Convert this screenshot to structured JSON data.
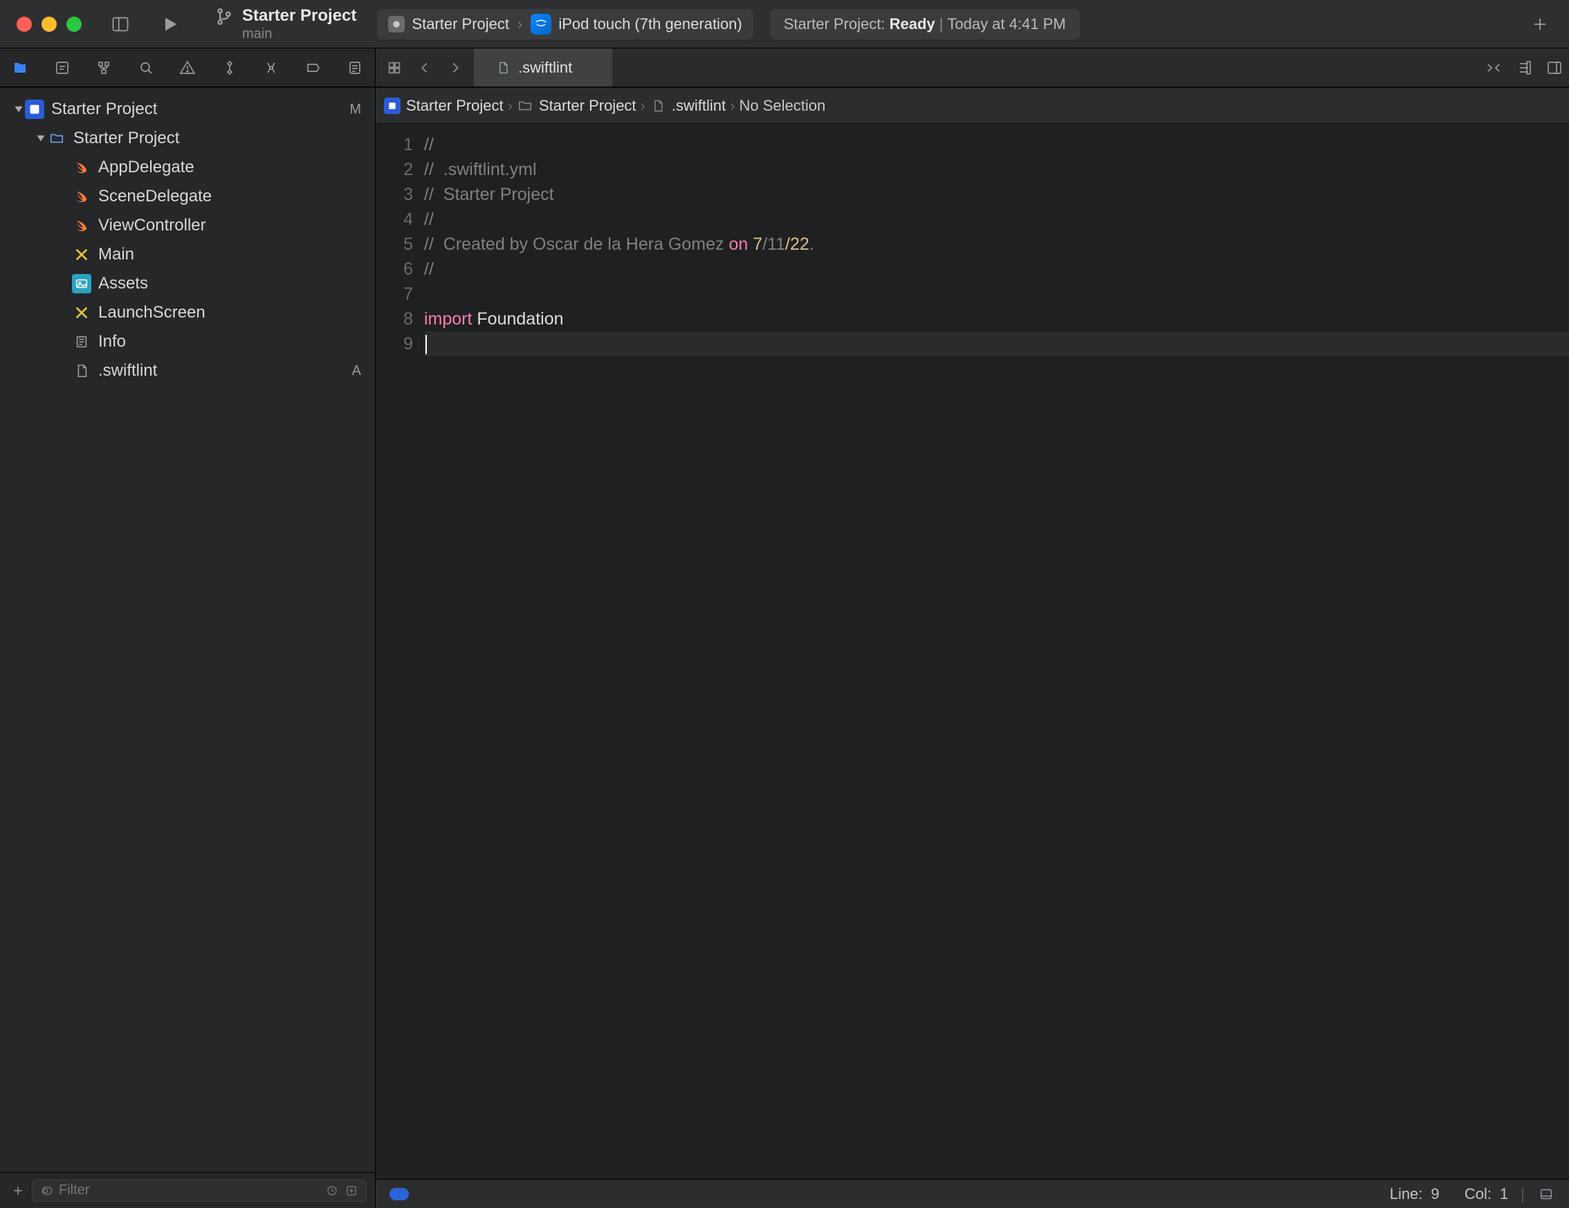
{
  "titlebar": {
    "project_title": "Starter Project",
    "branch": "main",
    "scheme": "Starter Project",
    "device": "iPod touch (7th generation)",
    "status_prefix": "Starter Project:",
    "status_state": "Ready",
    "status_time": "Today at 4:41 PM"
  },
  "navigator_icons": [
    "folder",
    "source-control",
    "symbols",
    "search",
    "issues",
    "tests",
    "debug",
    "breakpoints",
    "reports"
  ],
  "tree": {
    "root": {
      "name": "Starter Project",
      "badge": "M"
    },
    "group": {
      "name": "Starter Project"
    },
    "files": [
      {
        "name": "AppDelegate",
        "type": "swift"
      },
      {
        "name": "SceneDelegate",
        "type": "swift"
      },
      {
        "name": "ViewController",
        "type": "swift"
      },
      {
        "name": "Main",
        "type": "xib"
      },
      {
        "name": "Assets",
        "type": "assets"
      },
      {
        "name": "LaunchScreen",
        "type": "xib"
      },
      {
        "name": "Info",
        "type": "plist"
      },
      {
        "name": ".swiftlint",
        "type": "text",
        "badge": "A"
      }
    ]
  },
  "sidebar_filter": {
    "placeholder": "Filter"
  },
  "open_tab": {
    "filename": ".swiftlint"
  },
  "path_bar": {
    "project": "Starter Project",
    "group": "Starter Project",
    "file": ".swiftlint",
    "selection": "No Selection"
  },
  "code_lines": [
    {
      "n": 1,
      "kind": "comment",
      "text": "//"
    },
    {
      "n": 2,
      "kind": "comment",
      "text": "//  .swiftlint.yml"
    },
    {
      "n": 3,
      "kind": "comment",
      "text": "//  Starter Project"
    },
    {
      "n": 4,
      "kind": "comment",
      "text": "//"
    },
    {
      "n": 5,
      "kind": "created",
      "prefix": "//  Created by Oscar de la Hera Gomez ",
      "keyword": "on",
      "date_a": " 7",
      "date_b": "/11",
      "date_c": "/22",
      "suffix": "."
    },
    {
      "n": 6,
      "kind": "comment",
      "text": "//"
    },
    {
      "n": 7,
      "kind": "blank",
      "text": ""
    },
    {
      "n": 8,
      "kind": "import",
      "kw": "import",
      "mod": " Foundation"
    },
    {
      "n": 9,
      "kind": "cursor",
      "text": ""
    }
  ],
  "editor_footer": {
    "line_label": "Line:",
    "line_value": "9",
    "col_label": "Col:",
    "col_value": "1"
  }
}
